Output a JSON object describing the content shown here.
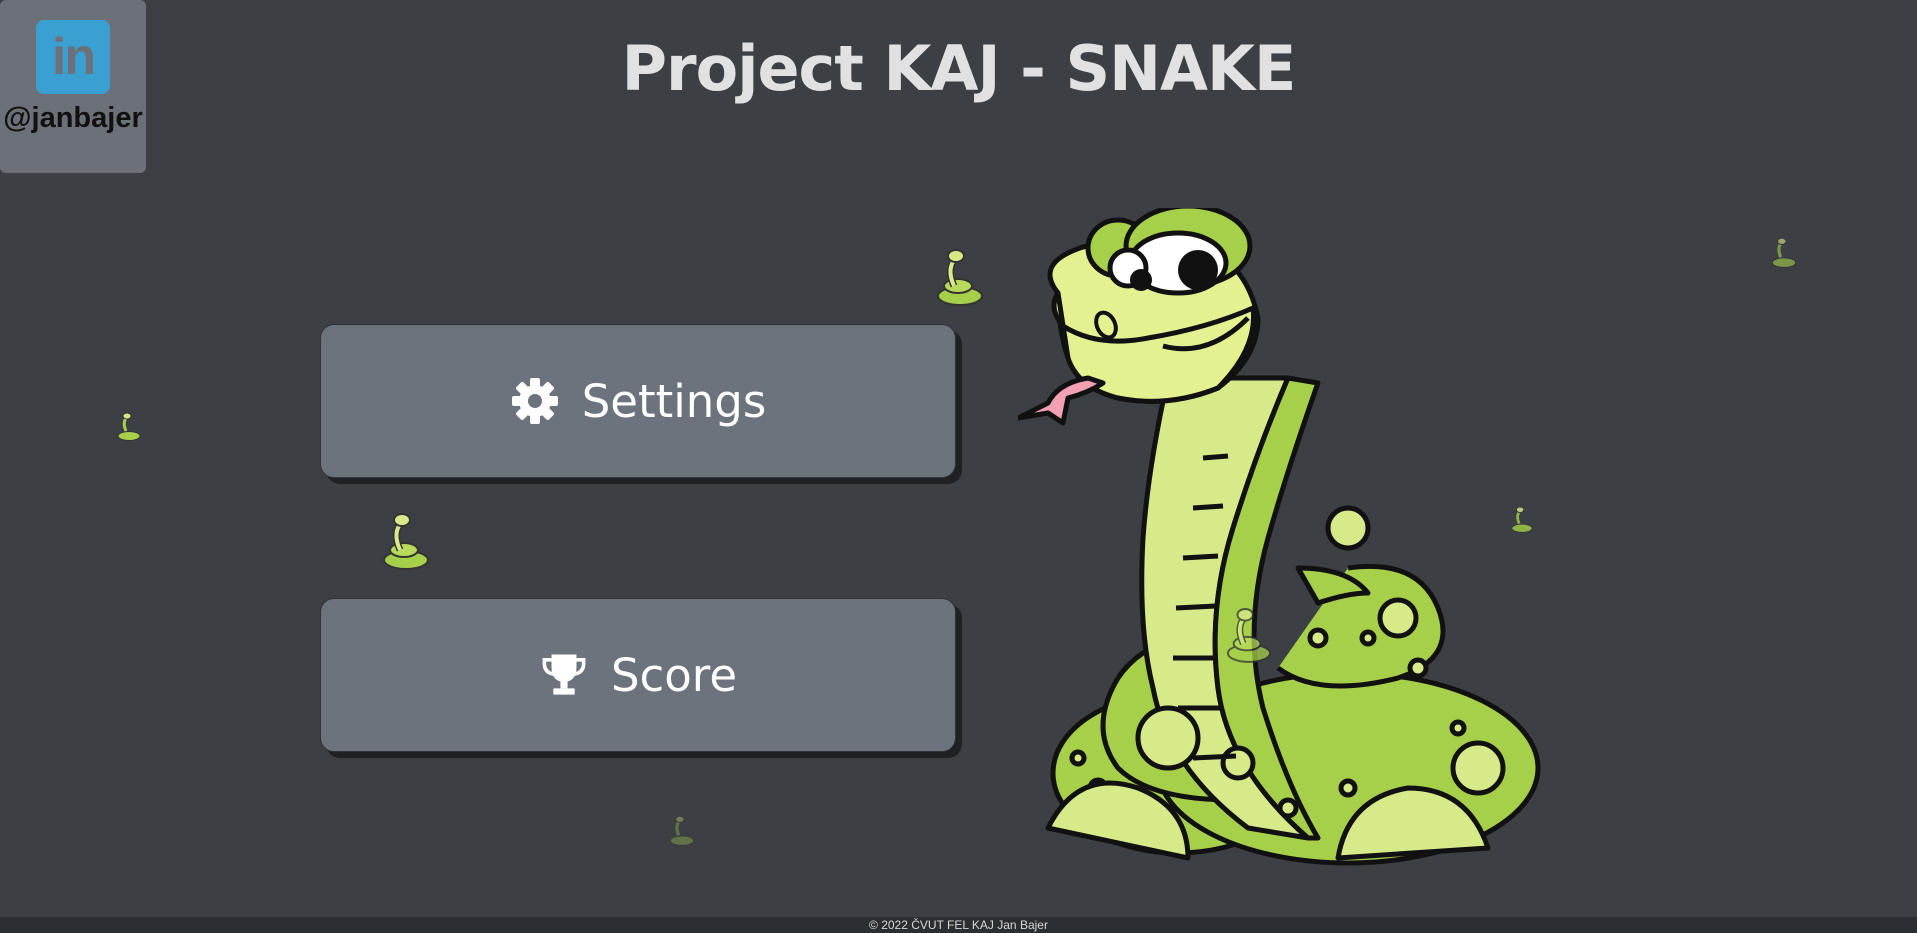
{
  "linkedin": {
    "handle": "@janbajer",
    "logo_text": "in",
    "brand_color": "#3a9fd1"
  },
  "title": "Project KAJ - SNAKE",
  "menu": {
    "settings_label": "Settings",
    "settings_icon": "gear-icon",
    "score_label": "Score",
    "score_icon": "trophy-icon"
  },
  "footer": {
    "text": "© 2022 ČVUT FEL KAJ Jan Bajer"
  },
  "colors": {
    "background": "#3c4045",
    "button": "#6c737c",
    "snake": "#a6cf4a"
  }
}
